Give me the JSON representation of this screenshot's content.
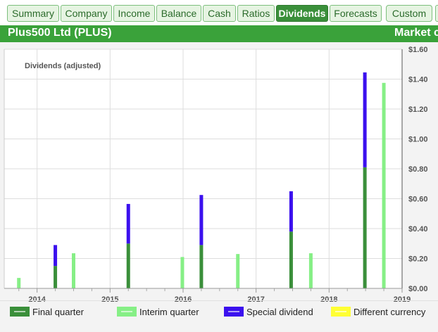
{
  "tabs": [
    {
      "label": "Summary",
      "active": false
    },
    {
      "label": "Company",
      "active": false
    },
    {
      "label": "Income",
      "active": false
    },
    {
      "label": "Balance",
      "active": false
    },
    {
      "label": "Cash",
      "active": false
    },
    {
      "label": "Ratios",
      "active": false
    },
    {
      "label": "Dividends",
      "active": true
    },
    {
      "label": "Forecasts",
      "active": false
    },
    {
      "label": "Custom",
      "active": false
    }
  ],
  "header": {
    "title": "Plus500 Ltd (PLUS)",
    "right_text": "Market c"
  },
  "colors": {
    "final": "#3a8f3a",
    "interim": "#86ef86",
    "special": "#3b10ee",
    "currency": "#ffff33",
    "header_bg": "#3aa23a",
    "tab_active": "#3a8f3a"
  },
  "chart_data": {
    "type": "bar",
    "title": "Dividends (adjusted)",
    "xlim": [
      2013.55,
      2019.0
    ],
    "ylim": [
      0,
      1.6
    ],
    "x_ticks": [
      2014,
      2015,
      2016,
      2017,
      2018,
      2019
    ],
    "y_ticks": [
      "$0.00",
      "$0.20",
      "$0.40",
      "$0.60",
      "$0.80",
      "$1.00",
      "$1.20",
      "$1.40",
      "$1.60"
    ],
    "y_tick_values": [
      0,
      0.2,
      0.4,
      0.6,
      0.8,
      1.0,
      1.2,
      1.4,
      1.6
    ],
    "grid": true,
    "legend": [
      "Final quarter",
      "Interim quarter",
      "Special dividend",
      "Different currency"
    ],
    "legend_position": "bottom",
    "bars": [
      {
        "x": 2013.75,
        "type": "interim",
        "value": 0.07
      },
      {
        "x": 2014.25,
        "type": "final",
        "value": 0.15,
        "special": 0.14
      },
      {
        "x": 2014.5,
        "type": "interim",
        "value": 0.235
      },
      {
        "x": 2015.25,
        "type": "final",
        "value": 0.3,
        "special": 0.265
      },
      {
        "x": 2015.99,
        "type": "interim",
        "value": 0.21
      },
      {
        "x": 2016.25,
        "type": "final",
        "value": 0.29,
        "special": 0.335
      },
      {
        "x": 2016.75,
        "type": "interim",
        "value": 0.23
      },
      {
        "x": 2017.48,
        "type": "final",
        "value": 0.38,
        "special": 0.27
      },
      {
        "x": 2017.75,
        "type": "interim",
        "value": 0.235
      },
      {
        "x": 2018.49,
        "type": "final",
        "value": 0.81,
        "special": 0.635
      },
      {
        "x": 2018.75,
        "type": "interim",
        "value": 1.375
      }
    ]
  }
}
